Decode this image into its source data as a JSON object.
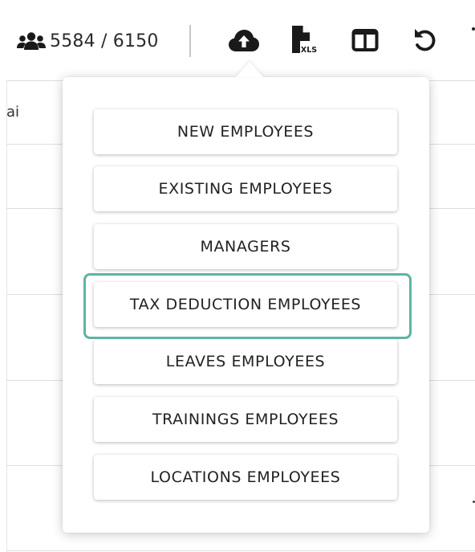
{
  "toolbar": {
    "employee_count": "5584 / 6150",
    "icons": {
      "users": "users-icon",
      "upload": "cloud-upload-icon",
      "xls": "xls-file-icon",
      "xls_badge": "XLS",
      "columns": "columns-icon",
      "reset": "undo-icon",
      "more": "more-vertical-icon"
    }
  },
  "table": {
    "partial_column_label": "ai"
  },
  "upload_menu": {
    "items": [
      {
        "label": "NEW EMPLOYEES"
      },
      {
        "label": "EXISTING EMPLOYEES"
      },
      {
        "label": "MANAGERS"
      },
      {
        "label": "TAX DEDUCTION EMPLOYEES",
        "highlighted": true
      },
      {
        "label": "LEAVES EMPLOYEES"
      },
      {
        "label": "TRAININGS EMPLOYEES"
      },
      {
        "label": "LOCATIONS EMPLOYEES"
      }
    ]
  },
  "colors": {
    "highlight": "#5bb5a5",
    "icon": "#1a1a1a",
    "divider": "#c8c8c8"
  }
}
